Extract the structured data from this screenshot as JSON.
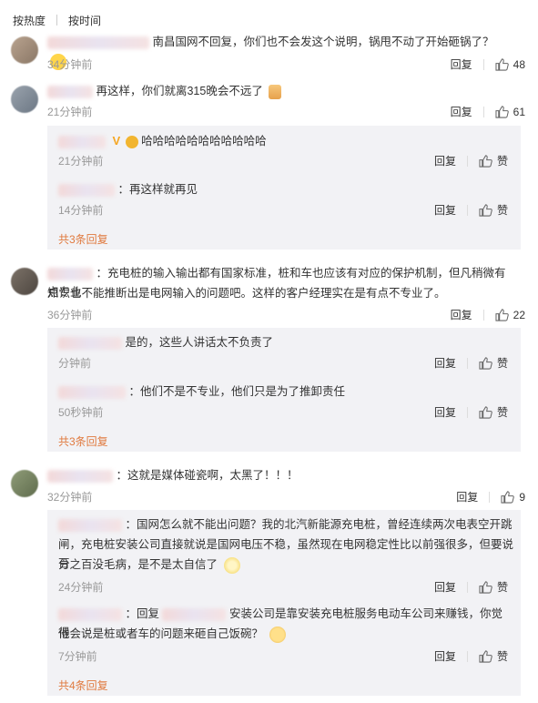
{
  "tabs": {
    "hot": "按热度",
    "time": "按时间"
  },
  "actions": {
    "reply": "回复",
    "like": "赞"
  },
  "comments": [
    {
      "text": "南昌国网不回复，你们也不会发这个说明，锅甩不动了开始砸锅了？",
      "time": "34分钟前",
      "likes": "48",
      "replies": []
    },
    {
      "text": "再这样，你们就离315晚会不远了",
      "time": "21分钟前",
      "likes": "61",
      "replies": [
        {
          "text": "哈哈哈哈哈哈哈哈哈哈哈",
          "time": "21分钟前",
          "likes": "赞"
        },
        {
          "text": "：再这样就再见",
          "time": "14分钟前",
          "likes": "赞"
        }
      ],
      "more": "共3条回复"
    },
    {
      "text1": "：充电桩的输入输出都有国家标准，桩和车也应该有对应的保护机制，但凡稍微有点专业",
      "text2": "知识也不能推断出是电网输入的问题吧。这样的客户经理实在是有点不专业了。",
      "time": "36分钟前",
      "likes": "22",
      "replies": [
        {
          "text": "是的，这些人讲话太不负责了",
          "time": "分钟前",
          "likes": "赞"
        },
        {
          "text": "：他们不是不专业，他们只是为了推卸责任",
          "time": "50秒钟前",
          "likes": "赞"
        }
      ],
      "more": "共3条回复"
    },
    {
      "text": "：这就是媒体碰瓷啊，太黑了！！！",
      "time": "32分钟前",
      "likes": "9",
      "replies": [
        {
          "text1": "：国网怎么就不能出问题？我的北汽新能源充电桩，曾经连续两次电表空开跳",
          "text2": "闸，充电桩安装公司直接就说是国网电压不稳，虽然现在电网稳定性比以前强很多，但要说百",
          "text3": "分之百没毛病，是不是太自信了",
          "time": "24分钟前",
          "likes": "赞"
        },
        {
          "prefix": "：回复",
          "text1": "安装公司是靠安装充电桩服务电动车公司来赚钱，你觉得",
          "text2": "他会说是桩或者车的问题来砸自己饭碗？",
          "time": "7分钟前",
          "likes": "赞"
        }
      ],
      "more": "共4条回复"
    }
  ],
  "icons": {
    "thumb": "thumbs-up-icon",
    "vip": "V"
  }
}
